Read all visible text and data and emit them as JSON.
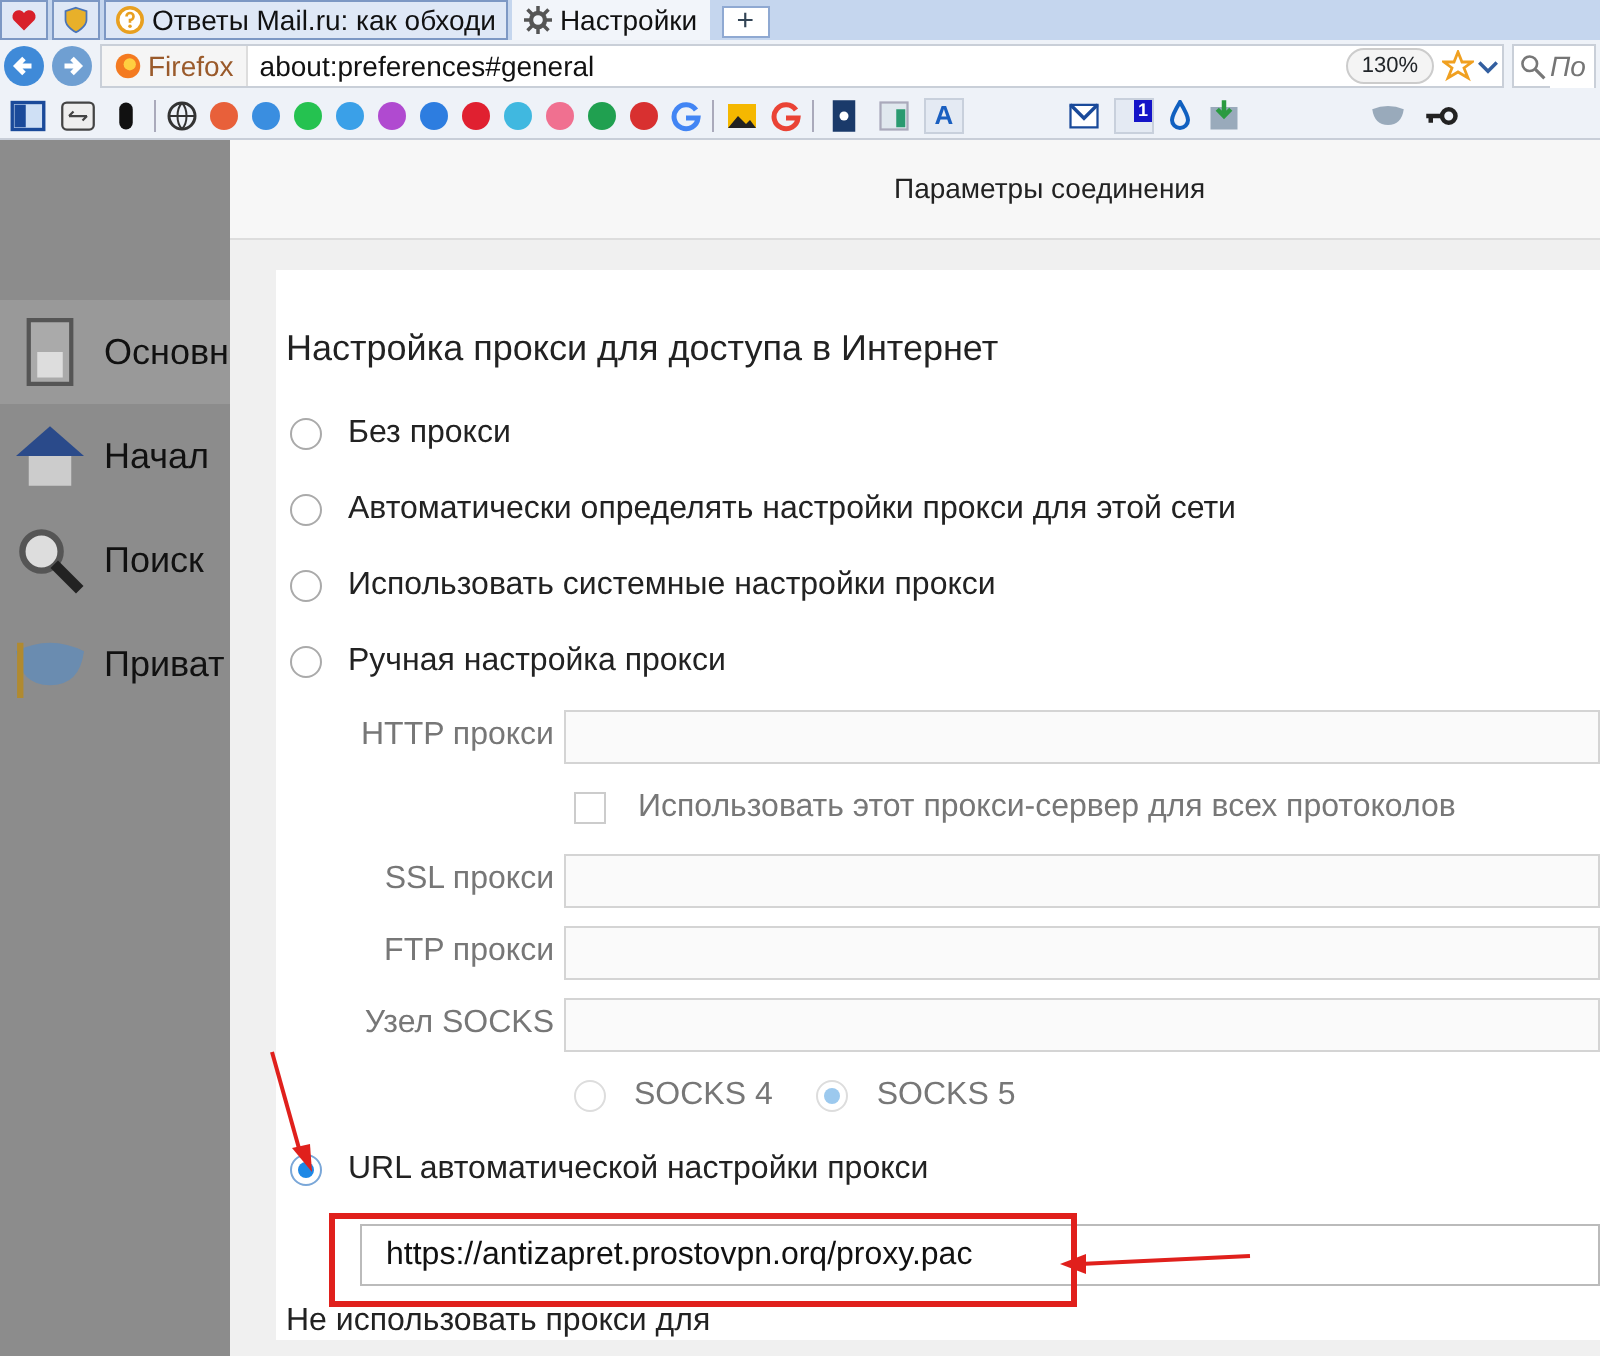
{
  "tabs": [
    {
      "kind": "pinned",
      "selected": false
    },
    {
      "kind": "pinned",
      "selected": false
    },
    {
      "kind": "page",
      "label": "Ответы Mail.ru: как обходи",
      "selected": false
    },
    {
      "kind": "page",
      "label": "Настройки",
      "selected": true
    }
  ],
  "new_tab_button": "+",
  "navbar": {
    "identity": "Firefox",
    "url": "about:preferences#general",
    "zoom": "130%",
    "search_placeholder": "По"
  },
  "bookmarks": {
    "letter_tile": "A",
    "mail_badge": "1"
  },
  "sidebar": {
    "items": [
      {
        "label": "Основн",
        "selected": true
      },
      {
        "label": "Начал",
        "selected": false
      },
      {
        "label": "Поиск",
        "selected": false
      },
      {
        "label": "Приват",
        "selected": false
      }
    ]
  },
  "dialog": {
    "title": "Параметры соединения",
    "heading": "Настройка прокси для доступа в Интернет",
    "options": [
      {
        "kind": "plain",
        "label": "Без прокси",
        "selected": false
      },
      {
        "kind": "plain",
        "label": "Автоматически определять настройки прокси для этой сети",
        "selected": false
      },
      {
        "kind": "plain",
        "label": "Использовать системные настройки прокси",
        "selected": false
      },
      {
        "kind": "manual",
        "label": "Ручная настройка прокси",
        "selected": false
      },
      {
        "kind": "url",
        "label": "URL автоматической настройки прокси",
        "selected": true
      }
    ],
    "manual": {
      "disabled": true,
      "fields": [
        {
          "label": "HTTP прокси"
        },
        {
          "label": "SSL прокси"
        },
        {
          "label": "FTP прокси"
        },
        {
          "label": "Узел SOCKS"
        }
      ],
      "share_checkbox": {
        "label": "Использовать этот прокси-сервер для всех протоколов",
        "checked": false
      },
      "socks_versions": [
        {
          "label": "SOCKS 4",
          "selected": false
        },
        {
          "label": "SOCKS 5",
          "selected": true
        }
      ]
    },
    "autoconfig_url": "https://antizapret.prostovpn.orq/proxy.pac",
    "no_proxy_label": "Не использовать прокси для"
  }
}
